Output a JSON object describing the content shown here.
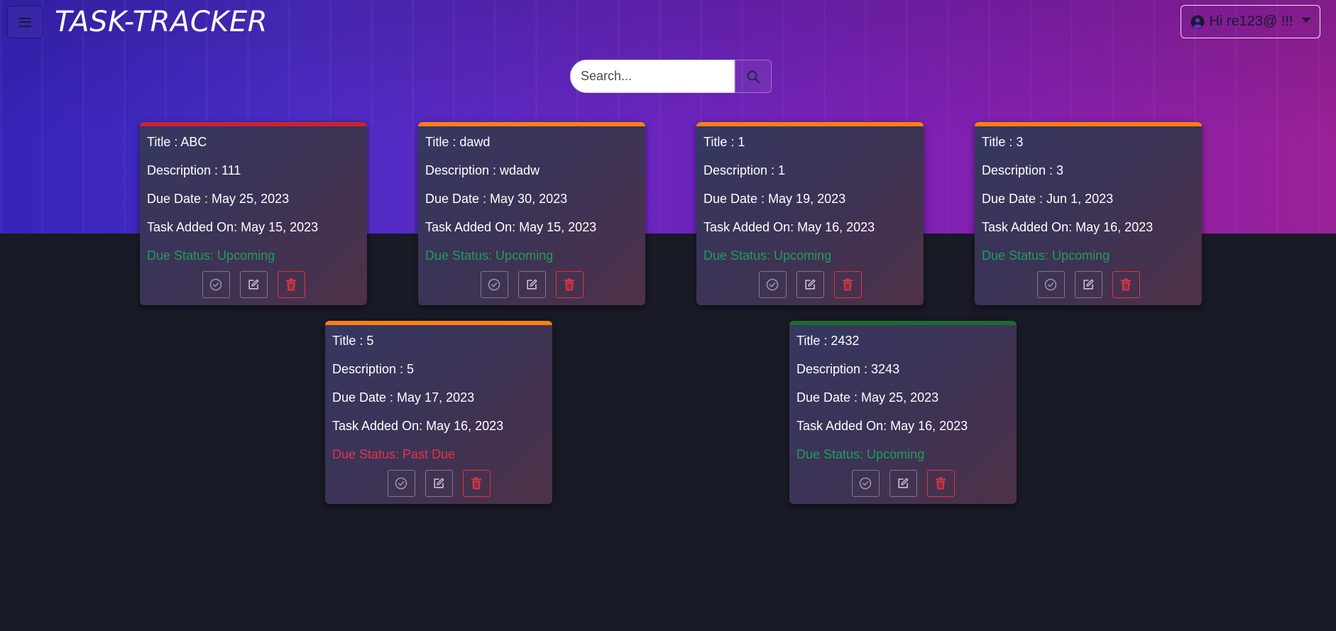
{
  "app": {
    "brand": "TASK-TRACKER",
    "user_greeting": "Hi re123@ !!!",
    "search": {
      "placeholder": "Search...",
      "value": ""
    }
  },
  "icons": {
    "menu": "hamburger-icon",
    "user": "user-circle-icon",
    "search": "search-icon",
    "complete": "check-circle-icon",
    "edit": "edit-icon",
    "delete": "trash-icon"
  },
  "colors": {
    "upcoming": "#1f9d5a",
    "past_due": "#e0344a",
    "red_bar": "#c82333",
    "orange_bar": "#fd7e14",
    "green_bar": "#1e6b2e"
  },
  "cards": [
    {
      "title": "Title : ABC",
      "description": "Description : 111",
      "due_date": "Due Date : May 25, 2023",
      "added_on": "Task Added On: May 15, 2023",
      "status": "Due Status: Upcoming",
      "status_kind": "upcoming",
      "bar_color": "#c82333"
    },
    {
      "title": "Title : dawd",
      "description": "Description : wdadw",
      "due_date": "Due Date : May 30, 2023",
      "added_on": "Task Added On: May 15, 2023",
      "status": "Due Status: Upcoming",
      "status_kind": "upcoming",
      "bar_color": "#fd7e14"
    },
    {
      "title": "Title : 1",
      "description": "Description : 1",
      "due_date": "Due Date : May 19, 2023",
      "added_on": "Task Added On: May 16, 2023",
      "status": "Due Status: Upcoming",
      "status_kind": "upcoming",
      "bar_color": "#fd7e14"
    },
    {
      "title": "Title : 3",
      "description": "Description : 3",
      "due_date": "Due Date : Jun 1, 2023",
      "added_on": "Task Added On: May 16, 2023",
      "status": "Due Status: Upcoming",
      "status_kind": "upcoming",
      "bar_color": "#fd7e14"
    },
    {
      "title": "Title : 5",
      "description": "Description : 5",
      "due_date": "Due Date : May 17, 2023",
      "added_on": "Task Added On: May 16, 2023",
      "status": "Due Status: Past Due",
      "status_kind": "past",
      "bar_color": "#fd7e14"
    },
    {
      "title": "Title : 2432",
      "description": "Description : 3243",
      "due_date": "Due Date : May 25, 2023",
      "added_on": "Task Added On: May 16, 2023",
      "status": "Due Status: Upcoming",
      "status_kind": "upcoming",
      "bar_color": "#1e6b2e"
    }
  ]
}
